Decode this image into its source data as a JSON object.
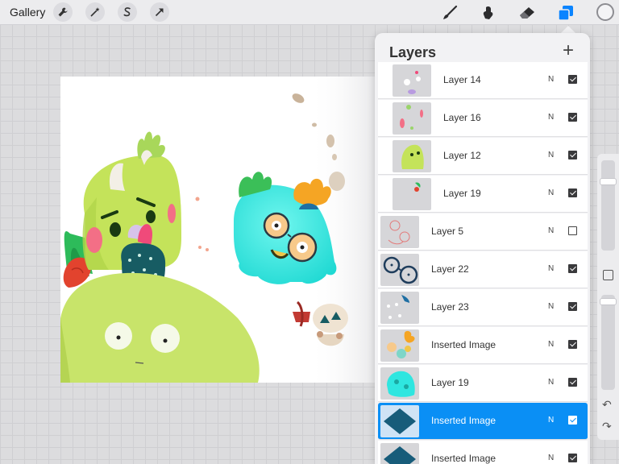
{
  "toolbar": {
    "gallery_label": "Gallery",
    "left_tools": [
      "wrench-icon",
      "magic-wand-icon",
      "selection-s-icon",
      "arrow-transform-icon"
    ],
    "right_tools": [
      "brush-icon",
      "smudge-icon",
      "eraser-icon",
      "layers-icon"
    ],
    "color_well": "#f4f4f6",
    "active_color": "#0a84ff"
  },
  "layers_panel": {
    "title": "Layers",
    "add_label": "+",
    "layers": [
      {
        "name": "Layer 14",
        "blend": "N",
        "visible": true,
        "grouped": true,
        "selected": false
      },
      {
        "name": "Layer 16",
        "blend": "N",
        "visible": true,
        "grouped": true,
        "selected": false
      },
      {
        "name": "Layer 12",
        "blend": "N",
        "visible": true,
        "grouped": true,
        "selected": false
      },
      {
        "name": "Layer 19",
        "blend": "N",
        "visible": true,
        "grouped": true,
        "selected": false
      },
      {
        "name": "Layer 5",
        "blend": "N",
        "visible": false,
        "grouped": false,
        "selected": false
      },
      {
        "name": "Layer 22",
        "blend": "N",
        "visible": true,
        "grouped": false,
        "selected": false
      },
      {
        "name": "Layer 23",
        "blend": "N",
        "visible": true,
        "grouped": false,
        "selected": false
      },
      {
        "name": "Inserted Image",
        "blend": "N",
        "visible": true,
        "grouped": false,
        "selected": false
      },
      {
        "name": "Layer 19",
        "blend": "N",
        "visible": true,
        "grouped": false,
        "selected": false
      },
      {
        "name": "Inserted Image",
        "blend": "N",
        "visible": true,
        "grouped": false,
        "selected": true
      },
      {
        "name": "Inserted Image",
        "blend": "N",
        "visible": true,
        "grouped": false,
        "selected": false
      }
    ]
  },
  "sidebar": {
    "undo_label": "↶",
    "redo_label": "↷"
  },
  "colors": {
    "selection": "#0a8ff5",
    "monster_green": "#c4e35a",
    "monster_cyan": "#2fe6e0",
    "cactus": "#175c63"
  }
}
